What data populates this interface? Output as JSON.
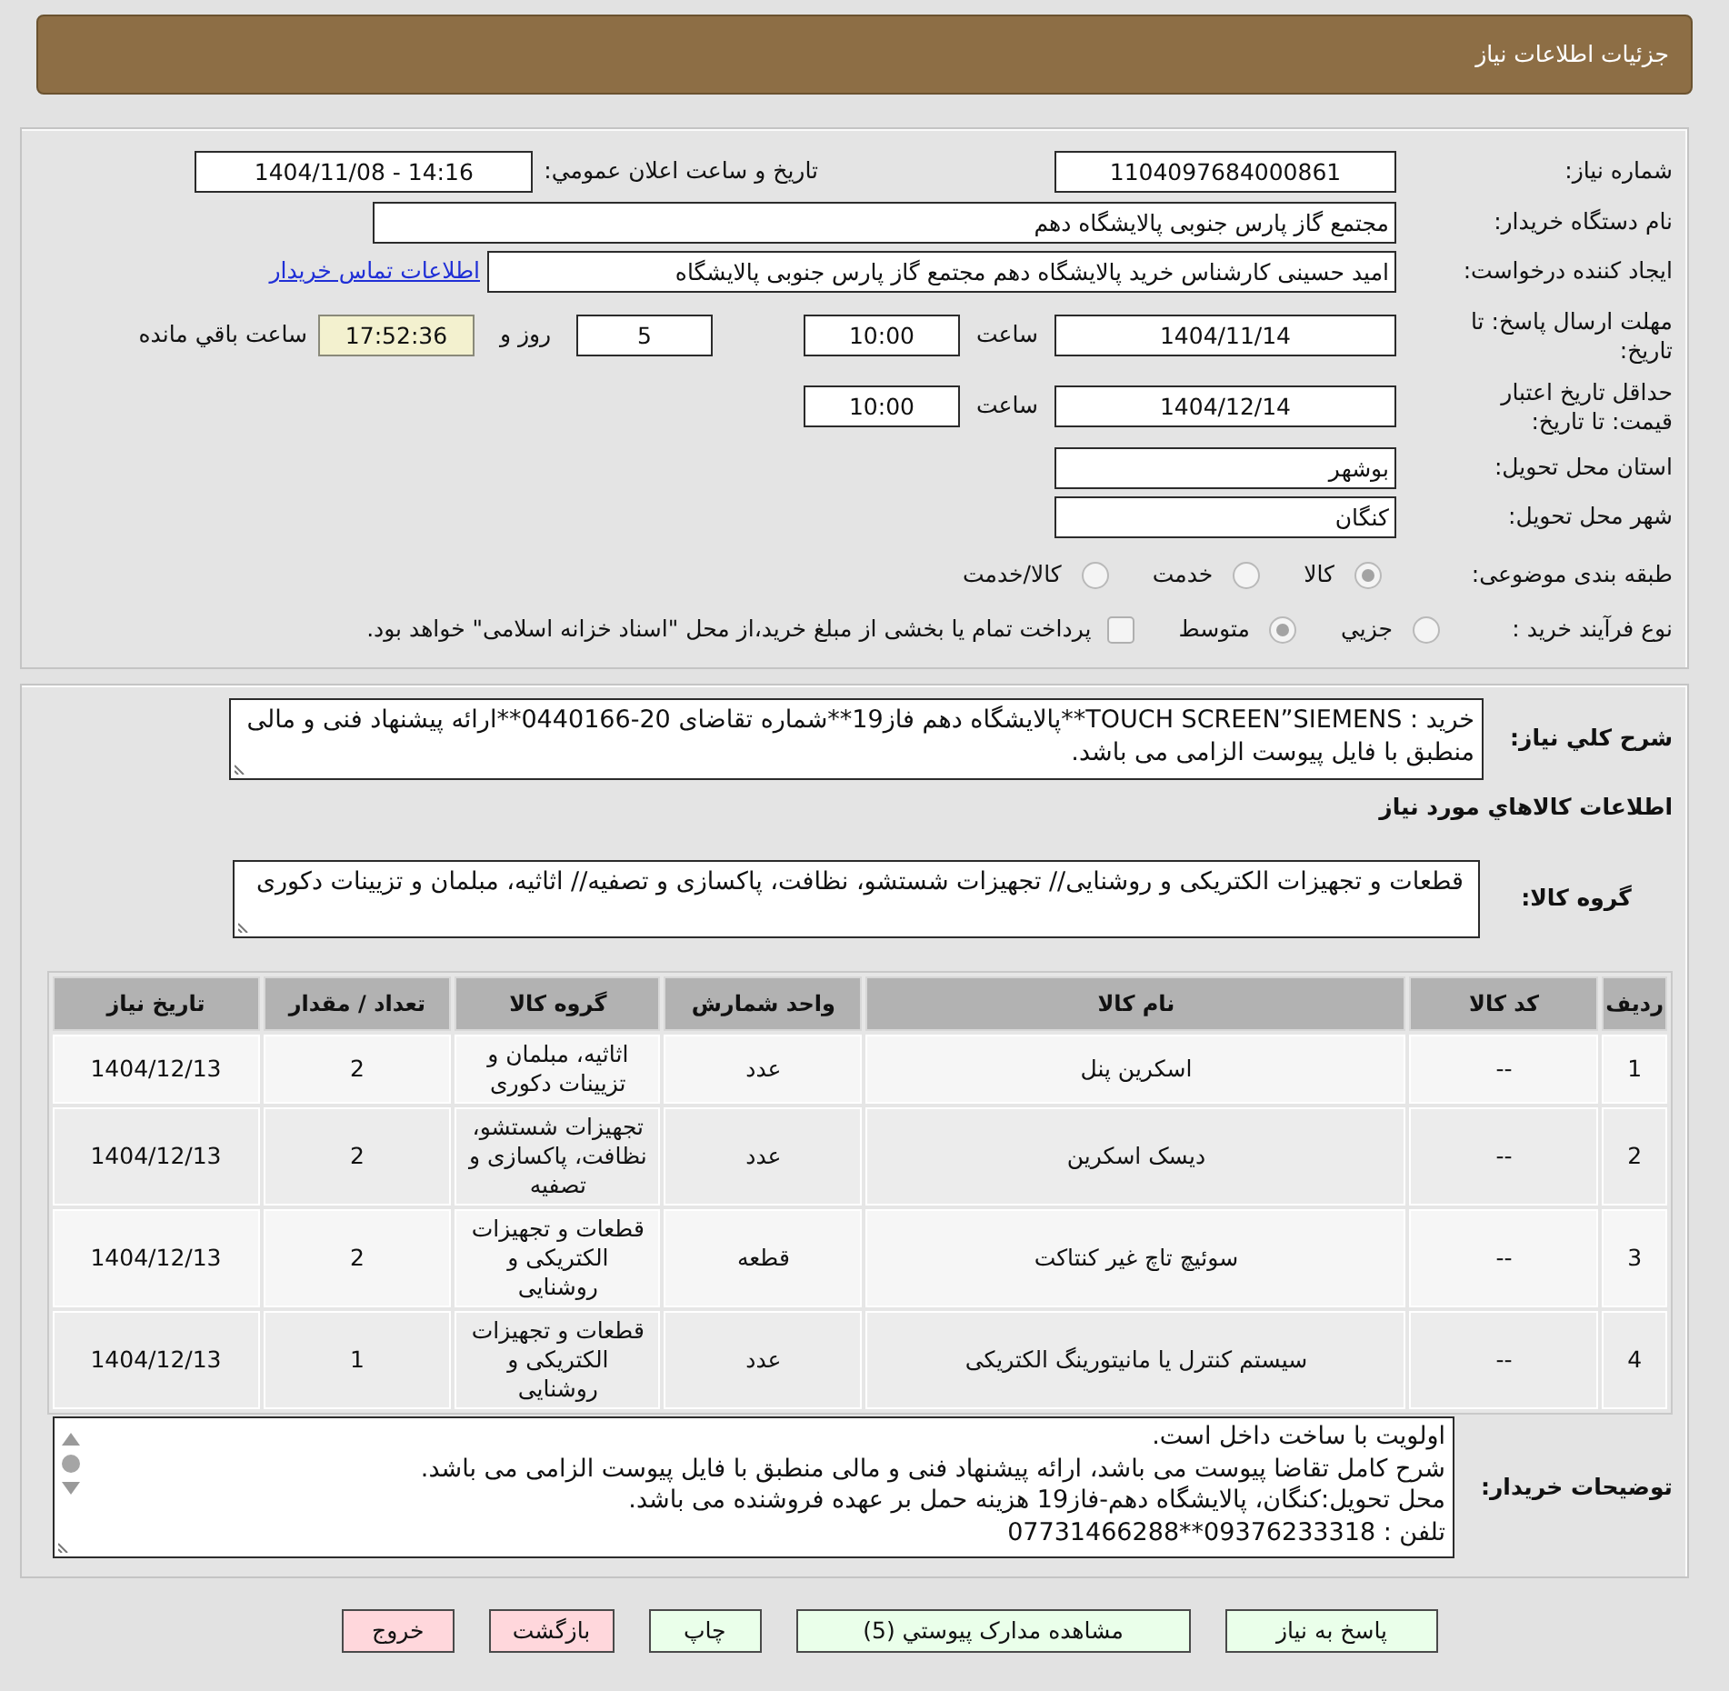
{
  "header": {
    "title": "جزئیات اطلاعات نیاز"
  },
  "details": {
    "need_number": {
      "label": "شماره نیاز:",
      "value": "1104097684000861"
    },
    "announce": {
      "label": "تاریخ و ساعت اعلان عمومي:",
      "value": "1404/11/08 - 14:16"
    },
    "buyer_org": {
      "label": "نام دستگاه خریدار:",
      "value": "مجتمع گاز پارس جنوبی  پالایشگاه دهم"
    },
    "requester": {
      "label": "ایجاد کننده درخواست:",
      "value": "امید حسینی کارشناس خرید پالایشگاه دهم  مجتمع گاز پارس جنوبی  پالایشگاه",
      "link": "اطلاعات تماس خریدار"
    },
    "deadline": {
      "label": "مهلت ارسال پاسخ: تا تاریخ:",
      "date": "1404/11/14",
      "time_label": "ساعت",
      "time": "10:00",
      "days": "5",
      "days_label": "روز و",
      "remaining": "17:52:36",
      "remaining_label": "ساعت باقي مانده"
    },
    "validity": {
      "label": "حداقل تاریخ اعتبار قیمت: تا تاریخ:",
      "date": "1404/12/14",
      "time_label": "ساعت",
      "time": "10:00"
    },
    "province": {
      "label": "استان محل تحویل:",
      "value": "بوشهر"
    },
    "city": {
      "label": "شهر محل تحویل:",
      "value": "کنگان"
    },
    "category": {
      "label": "طبقه بندی موضوعی:",
      "options": [
        {
          "label": "کالا",
          "selected": true
        },
        {
          "label": "خدمت",
          "selected": false
        },
        {
          "label": "کالا/خدمت",
          "selected": false
        }
      ]
    },
    "process": {
      "label": "نوع فرآیند خرید :",
      "options": [
        {
          "label": "جزيي",
          "selected": false
        },
        {
          "label": "متوسط",
          "selected": true
        }
      ],
      "treasury": {
        "label": "پرداخت تمام یا بخشی از مبلغ خرید،از محل \"اسناد خزانه اسلامی\" خواهد بود.",
        "checked": false
      }
    }
  },
  "description": {
    "label": "شرح کلي نیاز:",
    "value": "خرید : TOUCH SCREEN”SIEMENS**پالایشگاه دهم فاز19**شماره تقاضای 20-0440166**ارائه پیشنهاد فنی و مالی منطبق با فایل پیوست الزامی می باشد."
  },
  "goods": {
    "title": "اطلاعات کالاهاي مورد نیاز",
    "group_label": "گروه کالا:",
    "group_value": "قطعات و تجهیزات الکتریکی و روشنایی// تجهیزات شستشو، نظافت، پاکسازی و تصفیه// اثاثیه، مبلمان و تزیینات دکوری",
    "table": {
      "columns": [
        "ردیف",
        "کد کالا",
        "نام کالا",
        "واحد شمارش",
        "گروه کالا",
        "تعداد / مقدار",
        "تاریخ نیاز"
      ],
      "rows": [
        [
          "1",
          "--",
          "اسکرین پنل",
          "عدد",
          "اثاثیه، مبلمان و تزیینات دکوری",
          "2",
          "1404/12/13"
        ],
        [
          "2",
          "--",
          "دیسک اسکرین",
          "عدد",
          "تجهیزات شستشو، نظافت، پاکسازی و تصفیه",
          "2",
          "1404/12/13"
        ],
        [
          "3",
          "--",
          "سوئیچ تاچ غیر کنتاکت",
          "قطعه",
          "قطعات و تجهیزات الکتریکی و روشنایی",
          "2",
          "1404/12/13"
        ],
        [
          "4",
          "--",
          "سیستم کنترل یا مانیتورینگ الکتریکی",
          "عدد",
          "قطعات و تجهیزات الکتریکی و روشنایی",
          "1",
          "1404/12/13"
        ]
      ]
    }
  },
  "buyer_notes": {
    "label": "توضیحات خریدار:",
    "lines": [
      "اولویت با ساخت داخل است.",
      "شرح کامل تقاضا پیوست می باشد، ارائه پیشنهاد فنی و مالی منطبق با فایل پیوست الزامی می باشد.",
      "محل تحویل:کنگان، پالایشگاه دهم-فاز19 هزینه حمل بر عهده فروشنده می باشد.",
      "تلفن : 09376233318**07731466288"
    ]
  },
  "buttons": [
    {
      "label": "پاسخ به نیاز",
      "kind": "action"
    },
    {
      "label": "مشاهده مدارک پیوستي (5)",
      "kind": "action"
    },
    {
      "label": "چاپ",
      "kind": "action"
    },
    {
      "label": "بازگشت",
      "kind": "leave"
    },
    {
      "label": "خروج",
      "kind": "leave"
    }
  ]
}
